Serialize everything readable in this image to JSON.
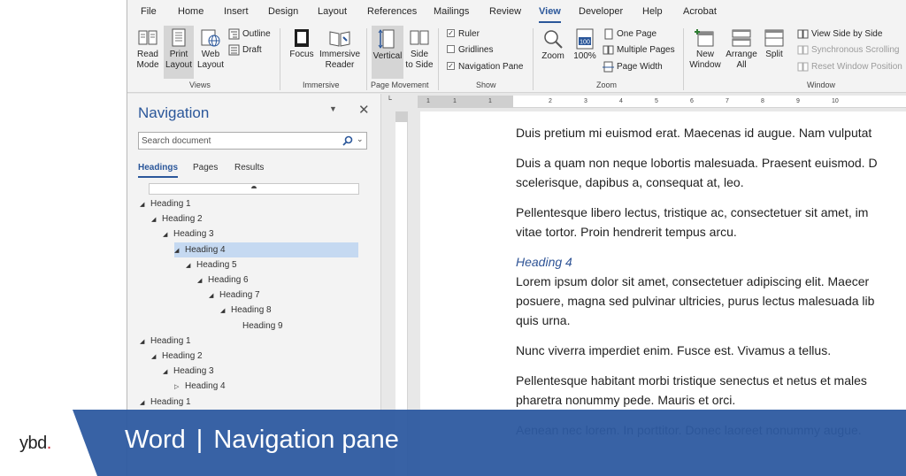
{
  "menu": {
    "tabs": [
      "File",
      "Home",
      "Insert",
      "Design",
      "Layout",
      "References",
      "Mailings",
      "Review",
      "View",
      "Developer",
      "Help",
      "Acrobat"
    ],
    "active": "View"
  },
  "ribbon": {
    "views": {
      "label": "Views",
      "read_mode": "Read\nMode",
      "print_layout": "Print\nLayout",
      "web_layout": "Web\nLayout",
      "outline": "Outline",
      "draft": "Draft"
    },
    "immersive": {
      "label": "Immersive",
      "focus": "Focus",
      "immersive_reader": "Immersive\nReader"
    },
    "page_movement": {
      "label": "Page Movement",
      "vertical": "Vertical",
      "side_to_side": "Side\nto Side"
    },
    "show": {
      "label": "Show",
      "ruler": "Ruler",
      "ruler_checked": true,
      "gridlines": "Gridlines",
      "gridlines_checked": false,
      "navigation_pane": "Navigation Pane",
      "navigation_pane_checked": true
    },
    "zoom": {
      "label": "Zoom",
      "zoom": "Zoom",
      "hundred": "100%",
      "hundred_icon_text": "100",
      "one_page": "One Page",
      "multiple_pages": "Multiple Pages",
      "page_width": "Page Width"
    },
    "window": {
      "label": "Window",
      "new_window": "New\nWindow",
      "arrange_all": "Arrange\nAll",
      "split": "Split",
      "view_side_by_side": "View Side by Side",
      "synchronous_scrolling": "Synchronous Scrolling",
      "reset_window_position": "Reset Window Position"
    }
  },
  "navigation": {
    "title": "Navigation",
    "search_placeholder": "Search document",
    "tabs": [
      "Headings",
      "Pages",
      "Results"
    ],
    "active_tab": "Headings",
    "headings": [
      {
        "text": "Heading 1",
        "level": 1,
        "expanded": true
      },
      {
        "text": "Heading 2",
        "level": 2,
        "expanded": true
      },
      {
        "text": "Heading 3",
        "level": 3,
        "expanded": true
      },
      {
        "text": "Heading 4",
        "level": 4,
        "expanded": true,
        "selected": true
      },
      {
        "text": "Heading 5",
        "level": 5,
        "expanded": true
      },
      {
        "text": "Heading 6",
        "level": 6,
        "expanded": true
      },
      {
        "text": "Heading 7",
        "level": 7,
        "expanded": true
      },
      {
        "text": "Heading 8",
        "level": 8,
        "expanded": true
      },
      {
        "text": "Heading 9",
        "level": 9,
        "leaf": true
      },
      {
        "text": "Heading 1",
        "level": 1,
        "expanded": true
      },
      {
        "text": "Heading 2",
        "level": 2,
        "expanded": true
      },
      {
        "text": "Heading 3",
        "level": 3,
        "expanded": true
      },
      {
        "text": "Heading 4",
        "level": 4,
        "expanded": false
      },
      {
        "text": "Heading 1",
        "level": 1,
        "expanded": true
      }
    ]
  },
  "ruler": {
    "ticks": [
      "1",
      "1",
      "1",
      "2",
      "3",
      "4",
      "5",
      "6",
      "7",
      "8",
      "9",
      "10"
    ]
  },
  "document": {
    "paragraphs": [
      {
        "text": "Duis pretium mi euismod erat. Maecenas id augue. Nam vulputat",
        "style": "body"
      },
      {
        "text": "Duis a quam non neque lobortis malesuada. Praesent euismod. D",
        "style": "body"
      },
      {
        "text": "scelerisque, dapibus a, consequat at, leo.",
        "style": "body"
      },
      {
        "text": "Pellentesque libero lectus, tristique ac, consectetuer sit amet, im",
        "style": "body"
      },
      {
        "text": "vitae tortor. Proin hendrerit tempus arcu.",
        "style": "body"
      },
      {
        "text": "Heading 4",
        "style": "heading"
      },
      {
        "text": "Lorem ipsum dolor sit amet, consectetuer adipiscing elit. Maecer",
        "style": "body"
      },
      {
        "text": "posuere, magna sed pulvinar ultricies, purus lectus malesuada lib",
        "style": "body"
      },
      {
        "text": "quis urna.",
        "style": "body"
      },
      {
        "text": "Nunc viverra imperdiet enim. Fusce est. Vivamus a tellus.",
        "style": "body"
      },
      {
        "text": "Pellentesque habitant morbi tristique senectus et netus et males",
        "style": "body"
      },
      {
        "text": "pharetra nonummy pede. Mauris et orci.",
        "style": "body"
      },
      {
        "text": "Aenean nec lorem. In porttitor. Donec laoreet nonummy augue.",
        "style": "body"
      }
    ]
  },
  "banner": {
    "logo": "ybd",
    "logo_dot": ".",
    "app": "Word",
    "separator": "|",
    "topic": "Navigation pane"
  },
  "colors": {
    "accent": "#2b579a",
    "banner": "#2d5aa0",
    "heading": "#2f5496",
    "logo_dot": "#d12f3a"
  }
}
